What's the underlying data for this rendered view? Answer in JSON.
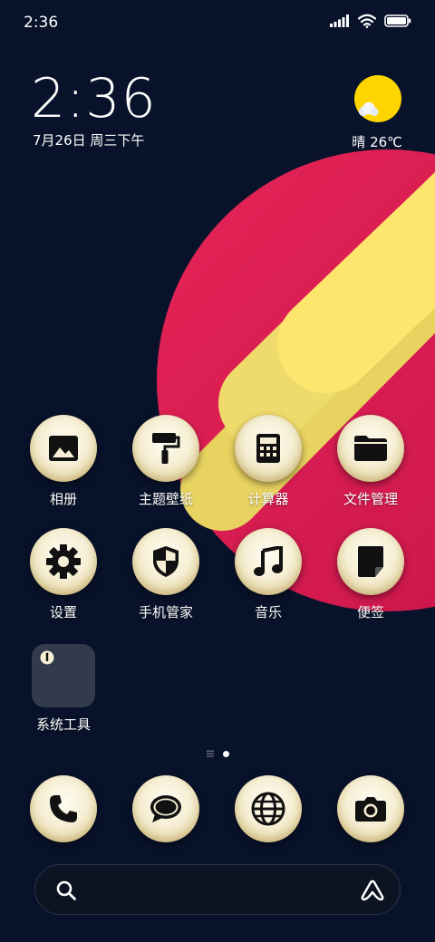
{
  "status_bar": {
    "time": "2:36",
    "icons": [
      "signal-icon",
      "wifi-icon",
      "battery-icon"
    ]
  },
  "clock_widget": {
    "time": "2:36",
    "date": "7月26日 周三下午"
  },
  "weather_widget": {
    "icon": "sunny-cloud-icon",
    "text": "晴 26℃"
  },
  "apps": [
    {
      "label": "相册",
      "icon": "gallery-icon"
    },
    {
      "label": "主题壁纸",
      "icon": "paint-roller-icon"
    },
    {
      "label": "计算器",
      "icon": "calculator-icon"
    },
    {
      "label": "文件管理",
      "icon": "folder-icon"
    },
    {
      "label": "设置",
      "icon": "gear-icon"
    },
    {
      "label": "手机管家",
      "icon": "shield-icon"
    },
    {
      "label": "音乐",
      "icon": "music-note-icon"
    },
    {
      "label": "便签",
      "icon": "note-icon"
    }
  ],
  "folder": {
    "label": "系统工具",
    "icon": "system-tools-folder-icon"
  },
  "dock": [
    {
      "icon": "phone-icon"
    },
    {
      "icon": "message-icon"
    },
    {
      "icon": "browser-globe-icon"
    },
    {
      "icon": "camera-icon"
    }
  ],
  "search": {
    "icon": "search-icon",
    "assistant_icon": "assistant-icon"
  },
  "colors": {
    "background": "#08122a",
    "wallpaper_red": "#df1c50",
    "wallpaper_yellow": "#f5e06a",
    "icon_base": "#f6efd5"
  }
}
